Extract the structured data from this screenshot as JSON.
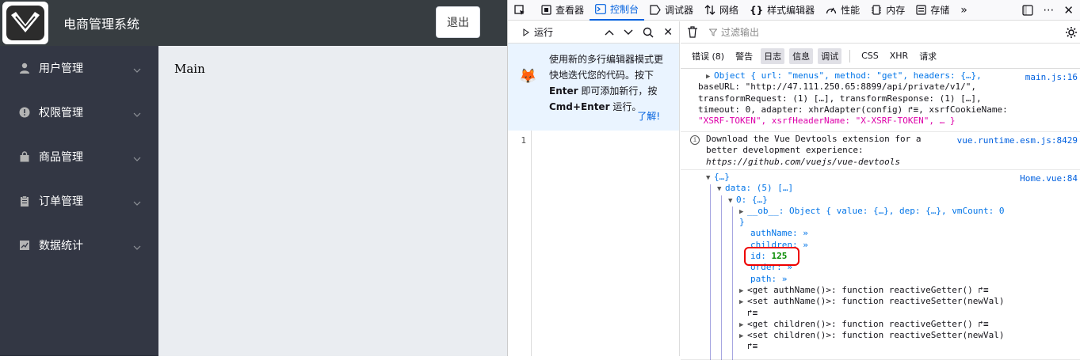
{
  "app": {
    "title": "电商管理系统",
    "logout_label": "退出",
    "main_text": "Main",
    "menu": [
      {
        "label": "用户管理",
        "icon": "user-icon"
      },
      {
        "label": "权限管理",
        "icon": "alert-icon"
      },
      {
        "label": "商品管理",
        "icon": "shopping-bag-icon"
      },
      {
        "label": "订单管理",
        "icon": "clipboard-icon"
      },
      {
        "label": "数据统计",
        "icon": "chart-icon"
      }
    ]
  },
  "devtools": {
    "tabs": [
      {
        "label": "查看器",
        "icon": "inspector-icon"
      },
      {
        "label": "控制台",
        "icon": "console-icon",
        "active": true
      },
      {
        "label": "调试器",
        "icon": "debugger-icon"
      },
      {
        "label": "网络",
        "icon": "network-icon"
      },
      {
        "label": "样式编辑器",
        "icon": "style-editor-icon"
      },
      {
        "label": "性能",
        "icon": "performance-icon"
      },
      {
        "label": "内存",
        "icon": "memory-icon"
      },
      {
        "label": "存储",
        "icon": "storage-icon"
      }
    ],
    "editor": {
      "run_label": "运行",
      "notice_line1": "使用新的多行编辑器模式更",
      "notice_line2": "快地迭代您的代码。按下",
      "notice_enter": "Enter",
      "notice_line3": " 即可添加新行，按",
      "notice_cmd": "Cmd+Enter",
      "notice_line4": " 运行。",
      "notice_link": "了解!",
      "line_number": "1"
    },
    "console": {
      "filter_placeholder": "过滤输出",
      "levels": [
        {
          "label": "错误 (8)",
          "on": false
        },
        {
          "label": "警告",
          "on": false
        },
        {
          "label": "日志",
          "on": true
        },
        {
          "label": "信息",
          "on": true
        },
        {
          "label": "调试",
          "on": true
        }
      ],
      "extra_filters": [
        "CSS",
        "XHR",
        "请求"
      ],
      "messages": [
        {
          "source": "main.js:16",
          "lines": [
            "Object { url: \"menus\", method: \"get\", headers: {…},",
            "baseURL: \"http://47.111.250.65:8899/api/private/v1/\",",
            "transformRequest: (1) […], transformResponse: (1) […],",
            "timeout: 0, adapter: xhrAdapter(config) ↱≡, xsrfCookieName:",
            "\"XSRF-TOKEN\", xsrfHeaderName: \"X-XSRF-TOKEN\", … }"
          ]
        },
        {
          "source": "vue.runtime.esm.js:8429",
          "lines": [
            "Download the Vue Devtools extension for a",
            "better development experience:",
            "https://github.com/vuejs/vue-devtools"
          ]
        },
        {
          "source": "Home.vue:84",
          "tree": {
            "root": "{…}",
            "data_line": "data: (5) […]",
            "item0": "0: {…}",
            "ob_line": "__ob__: Object { value: {…}, dep: {…}, vmCount: 0",
            "close": "}",
            "authName": "authName: »",
            "children": "children: »",
            "id_key": "id:",
            "id_value": "125",
            "order": "order: »",
            "path": "path: »",
            "get_authName": "<get authName()>: function reactiveGetter() ↱≡",
            "set_authName": "<set authName()>: function reactiveSetter(newVal)",
            "set_authName_cont": "↱≡",
            "get_children": "<get children()>: function reactiveGetter() ↱≡",
            "set_children": "<set children()>: function reactiveSetter(newVal)",
            "set_children_cont": "↱≡"
          }
        }
      ]
    }
  }
}
